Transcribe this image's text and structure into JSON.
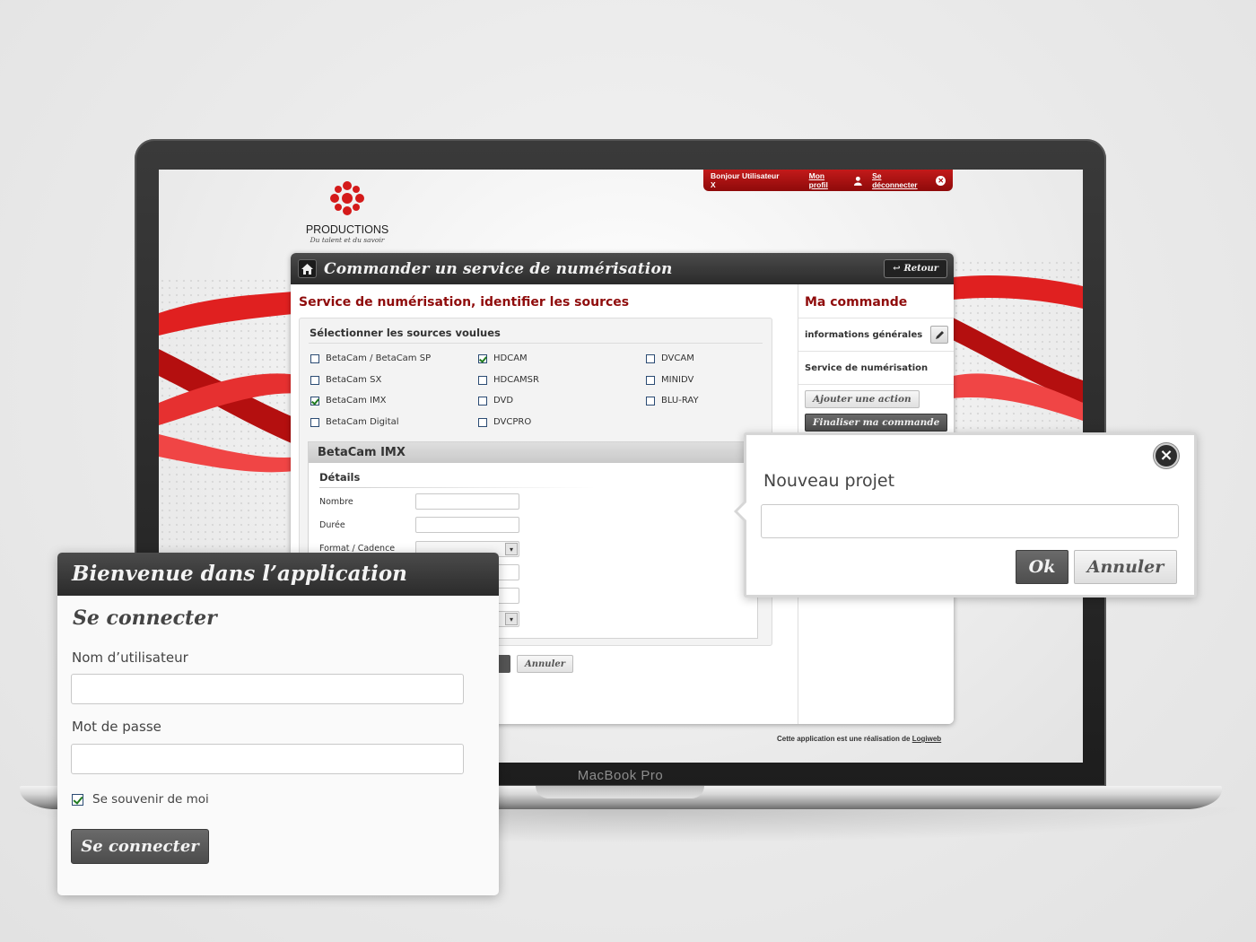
{
  "laptop": {
    "model_label": "MacBook Pro"
  },
  "app": {
    "logo": {
      "text": "PRODUCTIONS",
      "tagline": "Du talent et du savoir"
    },
    "topbar": {
      "greeting": "Bonjour Utilisateur X",
      "profile_link": "Mon profil",
      "logout_link": "Se déconnecter"
    },
    "panel": {
      "title": "Commander un service de numérisation",
      "back_button": "Retour",
      "section_title": "Service de numérisation, identifier les sources",
      "sources_title": "Sélectionner les sources voulues",
      "sources": [
        {
          "label": "BetaCam / BetaCam SP",
          "checked": false
        },
        {
          "label": "BetaCam SX",
          "checked": false
        },
        {
          "label": "BetaCam IMX",
          "checked": true
        },
        {
          "label": "BetaCam Digital",
          "checked": false
        },
        {
          "label": "HDCAM",
          "checked": true
        },
        {
          "label": "HDCAMSR",
          "checked": false
        },
        {
          "label": "DVD",
          "checked": false
        },
        {
          "label": "DVCPRO",
          "checked": false
        },
        {
          "label": "DVCAM",
          "checked": false
        },
        {
          "label": "MINIDV",
          "checked": false
        },
        {
          "label": "BLU-RAY",
          "checked": false
        }
      ],
      "detail_box": {
        "title": "BetaCam IMX",
        "details_title": "Détails",
        "fields": [
          "Nombre",
          "Durée",
          "Format / Cadence"
        ]
      },
      "cancel_button": "Annuler",
      "order": {
        "title": "Ma commande",
        "rows": [
          "informations générales",
          "Service de numérisation"
        ],
        "add_action_button": "Ajouter une action",
        "finalize_button": "Finaliser ma commande"
      }
    },
    "credit": {
      "prefix": "Cette application est une réalisation de",
      "link": "Logiweb"
    }
  },
  "popover": {
    "label": "Nouveau projet",
    "input_value": "",
    "ok_button": "Ok",
    "cancel_button": "Annuler",
    "close_glyph": "×"
  },
  "login": {
    "header": "Bienvenue dans l’application",
    "subtitle": "Se connecter",
    "username_label": "Nom d’utilisateur",
    "username_value": "",
    "password_label": "Mot de passe",
    "password_value": "",
    "remember_label": "Se souvenir de moi",
    "remember_checked": true,
    "submit_button": "Se connecter"
  },
  "colors": {
    "brand_red": "#c31a1a",
    "title_red": "#8f0c0c",
    "dark_header": "#2a2a2a"
  }
}
